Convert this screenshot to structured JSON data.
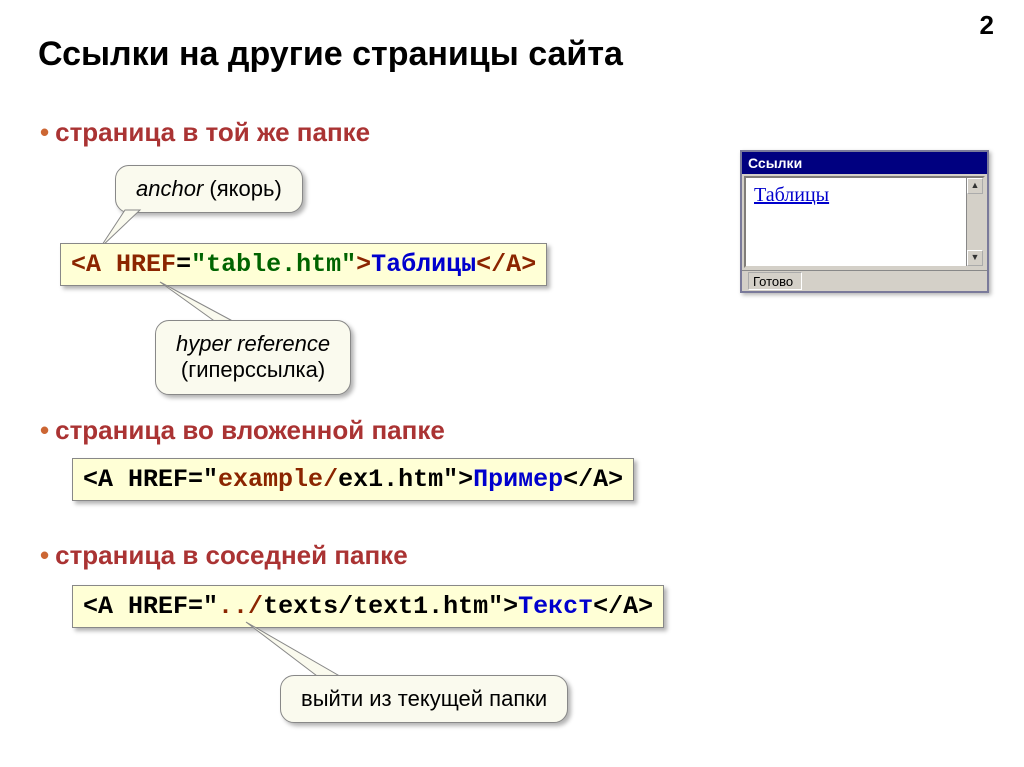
{
  "page_number": "2",
  "title": "Ссылки на другие страницы сайта",
  "bullets": {
    "b1": "страница в той же папке",
    "b2": "страница во вложенной папке",
    "b3": "страница в соседней папке"
  },
  "callouts": {
    "anchor_it": "anchor",
    "anchor_ru": " (якорь)",
    "hyper_it": "hyper reference",
    "hyper_ru": "(гиперссылка)",
    "exit_ru": "выйти из текущей папки"
  },
  "code1": {
    "open": "<",
    "tagA": "A",
    "sp1": " ",
    "href": "HREF",
    "eq": "=",
    "q1": "\"table.htm\"",
    "gt": ">",
    "text": "Таблицы",
    "close1": "</",
    "tagA2": "A",
    "close2": ">"
  },
  "code2": {
    "open": "<",
    "pre": "A HREF=\"",
    "folder": "example/",
    "file": "ex1.htm",
    "q": "\">",
    "text": "Пример",
    "close": "</A>"
  },
  "code3": {
    "open": "<",
    "pre": "A HREF=\"",
    "up": "../",
    "file": "texts/text1.htm",
    "q": "\">",
    "text": "Текст",
    "close": "</A>"
  },
  "browser": {
    "title": "Ссылки",
    "link": "Таблицы",
    "status": "Готово"
  }
}
